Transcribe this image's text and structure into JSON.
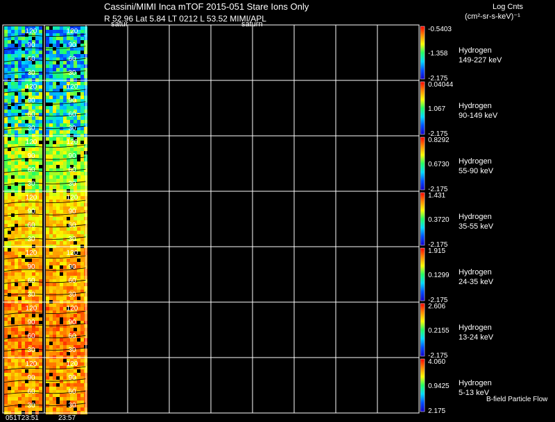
{
  "header": {
    "title": "Cassini/MIMI Inca mTOF  2015-051   Stare   Ions Only",
    "subtitle": "R      52.96 Lat 5.84 LT 0212 L        53.52  MIMI/APL",
    "label_left": "satur",
    "label_right": "saturn"
  },
  "colorbar_units": {
    "title": "Log Cnts",
    "units": "(cm²-sr-s-keV)⁻¹"
  },
  "footer_note": "B-field Particle Flow",
  "x_ticks": [
    "051T23:51",
    "23:57"
  ],
  "chart_data": {
    "type": "heatmap",
    "panels": [
      {
        "species": "Hydrogen",
        "energy": "149-227 keV",
        "cb_max": "-0.5403",
        "cb_mid": "-1.358",
        "cb_min": "-2.175",
        "y_ticks": [
          "120",
          "90",
          "60",
          "30"
        ],
        "mean_level": 0.35
      },
      {
        "species": "Hydrogen",
        "energy": "90-149 keV",
        "cb_max": "0.04044",
        "cb_mid": "1.067",
        "cb_min": "-2.175",
        "y_ticks": [
          "120",
          "90",
          "60",
          "30"
        ],
        "mean_level": 0.45
      },
      {
        "species": "Hydrogen",
        "energy": "55-90 keV",
        "cb_max": "0.8292",
        "cb_mid": "0.6730",
        "cb_min": "-2.175",
        "y_ticks": [
          "120",
          "90",
          "60",
          "30"
        ],
        "mean_level": 0.6
      },
      {
        "species": "Hydrogen",
        "energy": "35-55 keV",
        "cb_max": "1.431",
        "cb_mid": "0.3720",
        "cb_min": "-2.175",
        "y_ticks": [
          "120",
          "90",
          "60",
          "30"
        ],
        "mean_level": 0.72
      },
      {
        "species": "Hydrogen",
        "energy": "24-35 keV",
        "cb_max": "1.915",
        "cb_mid": "0.1299",
        "cb_min": "-2.175",
        "y_ticks": [
          "120",
          "90",
          "60",
          "30"
        ],
        "mean_level": 0.78
      },
      {
        "species": "Hydrogen",
        "energy": "13-24 keV",
        "cb_max": "2.606",
        "cb_mid": "0.2155",
        "cb_min": "-2.175",
        "y_ticks": [
          "120",
          "90",
          "60",
          "30"
        ],
        "mean_level": 0.84
      },
      {
        "species": "Hydrogen",
        "energy": "5-13 keV",
        "cb_max": "4.060",
        "cb_mid": "0.9425",
        "cb_min": "2.175",
        "y_ticks": [
          "120",
          "90",
          "60",
          "30"
        ],
        "mean_level": 0.8
      }
    ],
    "grid": true,
    "colormap": "rainbow (blue-low, red-high)",
    "accent_colors": {
      "grid": "#ffffff",
      "background": "#000000"
    }
  }
}
